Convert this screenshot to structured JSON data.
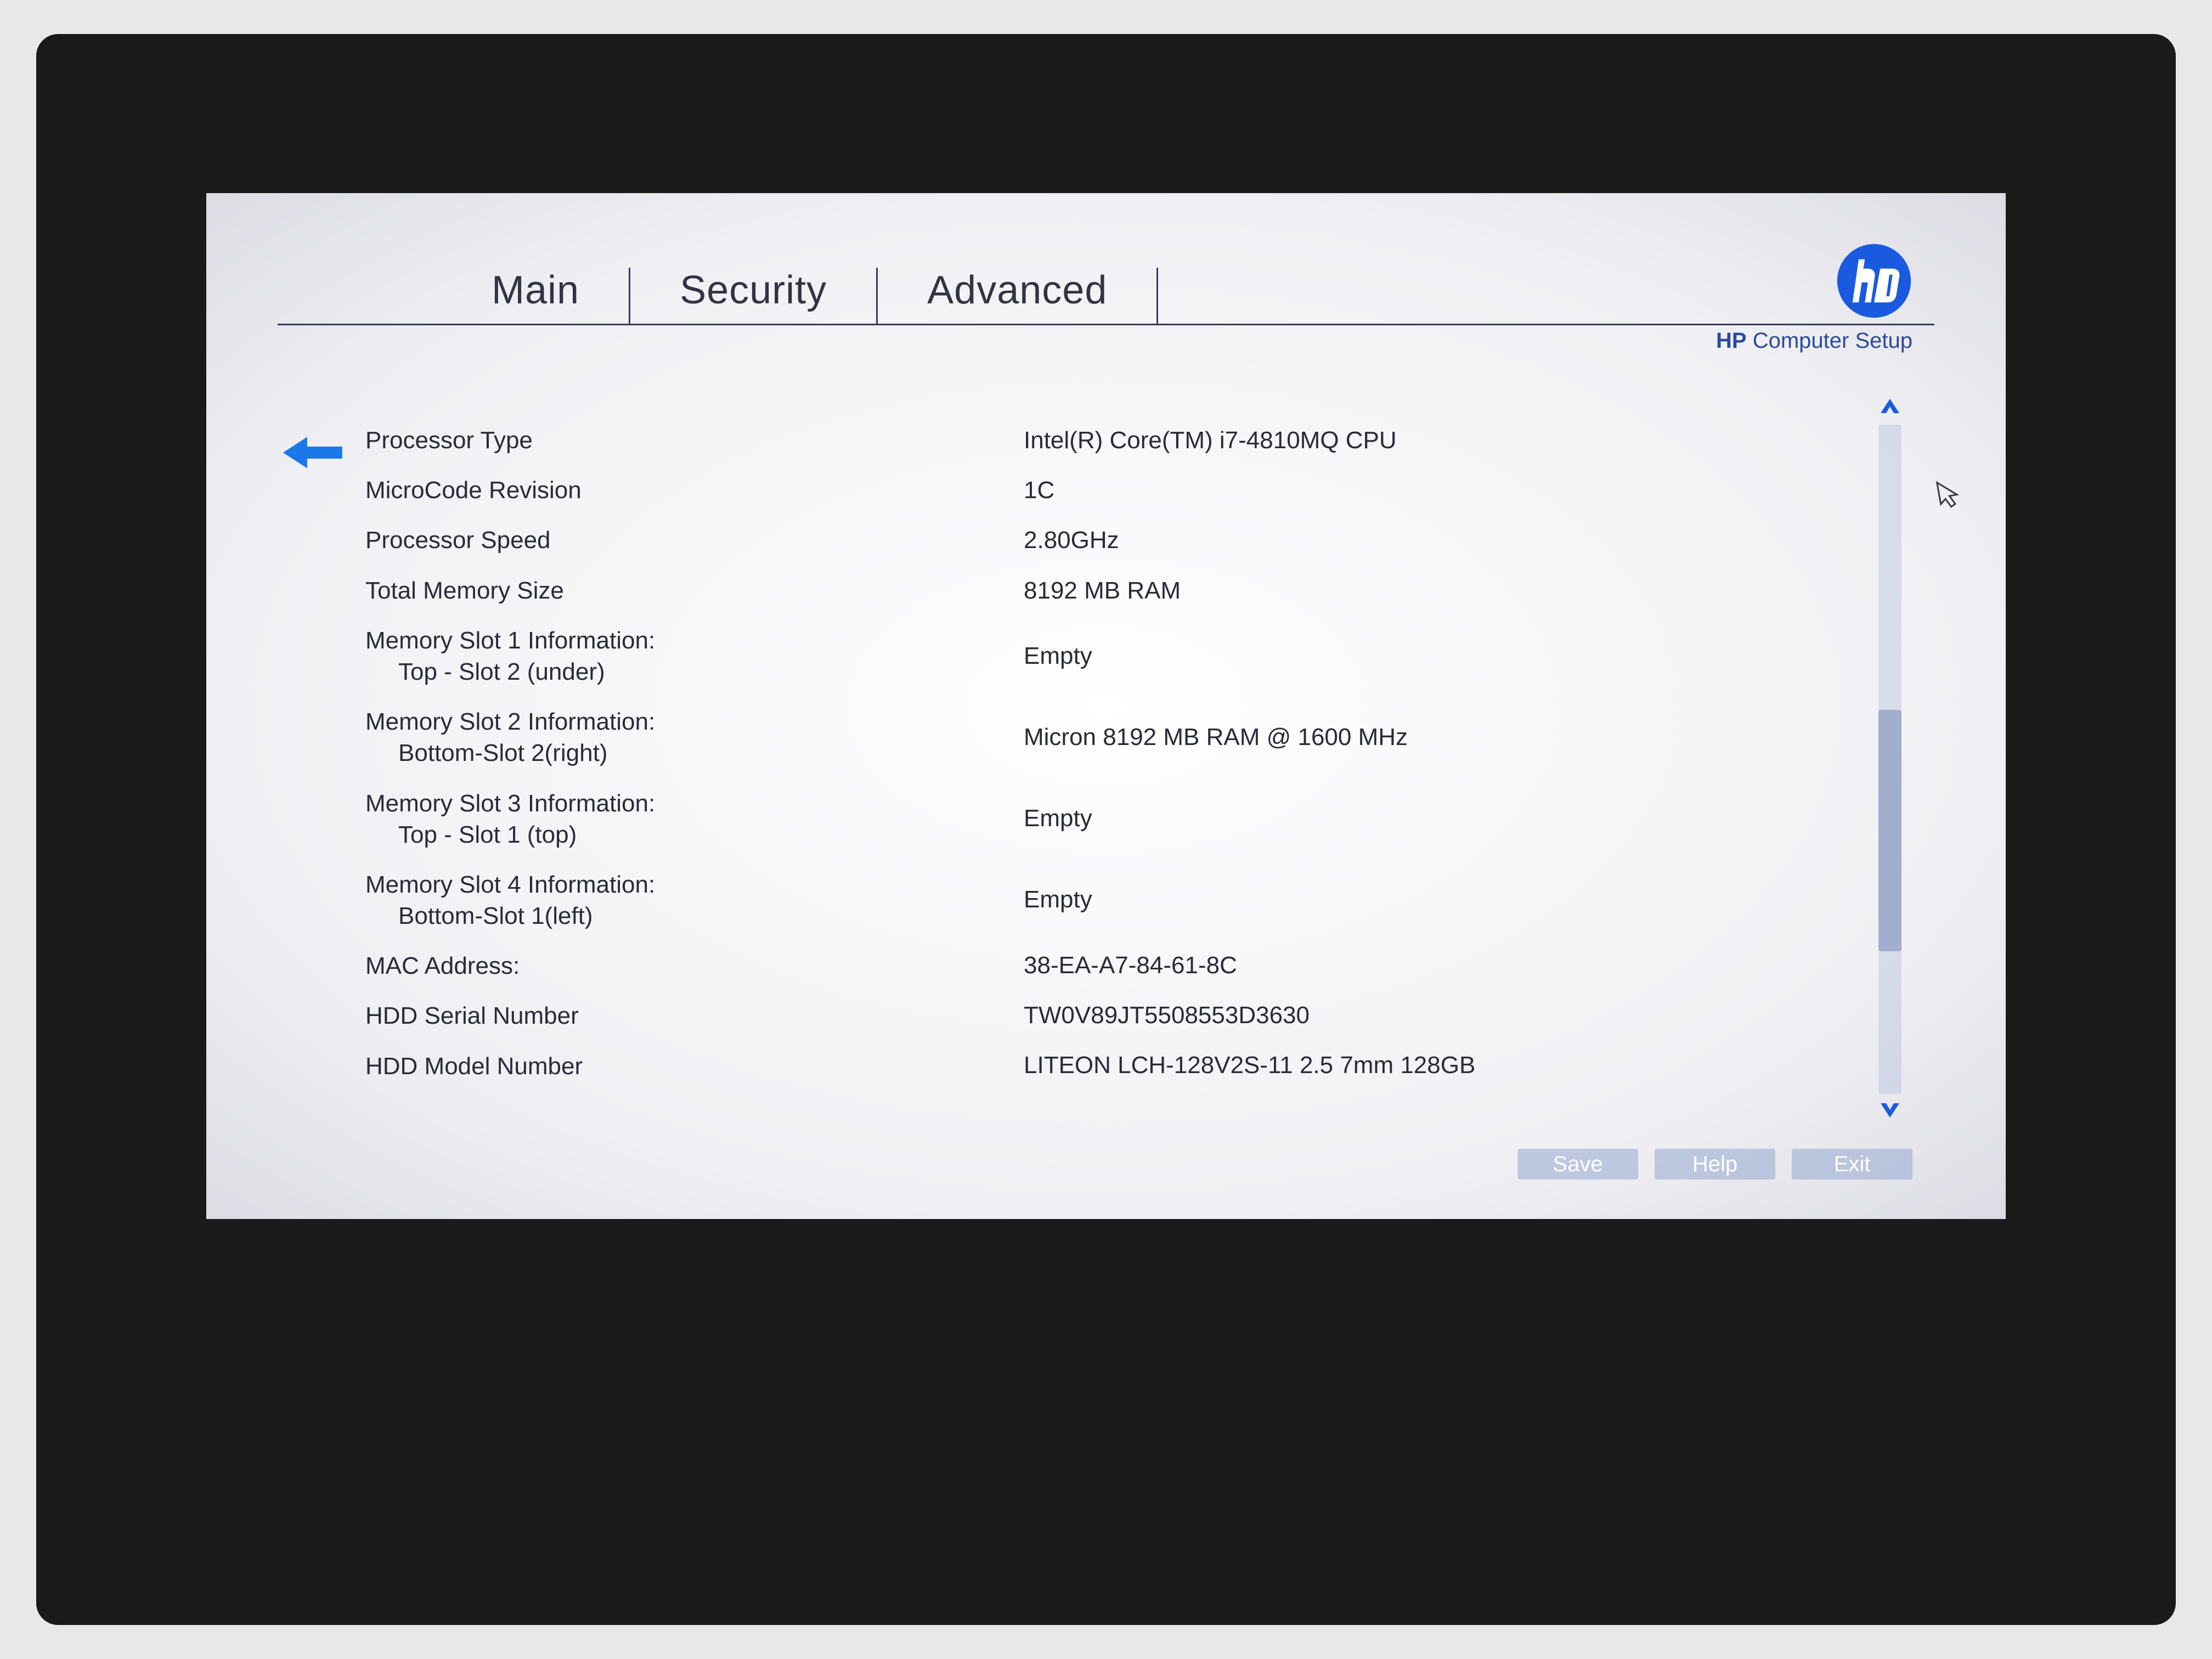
{
  "header": {
    "tabs": [
      "Main",
      "Security",
      "Advanced"
    ],
    "brand_prefix": "HP",
    "brand_suffix": " Computer Setup"
  },
  "info": {
    "rows": [
      {
        "label": "Processor Type",
        "value": "Intel(R) Core(TM) i7-4810MQ CPU"
      },
      {
        "label": "MicroCode Revision",
        "value": "1C"
      },
      {
        "label": "Processor Speed",
        "value": "2.80GHz"
      },
      {
        "label": "Total Memory Size",
        "value": "8192 MB RAM"
      }
    ],
    "mem_slots": [
      {
        "label": "Memory Slot 1 Information:",
        "sub": "Top - Slot 2 (under)",
        "value": "Empty"
      },
      {
        "label": "Memory Slot 2 Information:",
        "sub": "Bottom-Slot 2(right)",
        "value": "Micron 8192 MB RAM @ 1600 MHz"
      },
      {
        "label": "Memory Slot 3 Information:",
        "sub": "Top - Slot 1 (top)",
        "value": "Empty"
      },
      {
        "label": "Memory Slot 4 Information:",
        "sub": "Bottom-Slot 1(left)",
        "value": "Empty"
      }
    ],
    "tail_rows": [
      {
        "label": "MAC Address:",
        "value": "38-EA-A7-84-61-8C"
      },
      {
        "label": "HDD Serial Number",
        "value": "TW0V89JT5508553D3630"
      },
      {
        "label": "HDD Model Number",
        "value": "LITEON LCH-128V2S-11 2.5 7mm 128GB"
      }
    ]
  },
  "footer": {
    "save": "Save",
    "help": "Help",
    "exit": "Exit"
  }
}
